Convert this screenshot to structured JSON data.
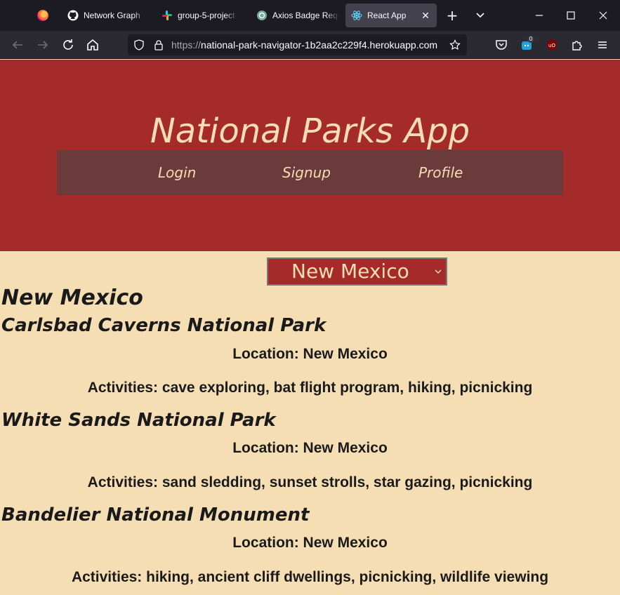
{
  "browser": {
    "tabs": [
      {
        "label": "Network Graph · ",
        "icon": "github-icon",
        "active": false
      },
      {
        "label": "group-5-project-",
        "icon": "slack-icon",
        "active": false
      },
      {
        "label": "Axios Badge Requ",
        "icon": "chatgpt-icon",
        "active": false
      },
      {
        "label": "React App",
        "icon": "react-icon",
        "active": true
      }
    ],
    "url_prefix": "https://",
    "url_domain": "national-park-navigator-1b2aa2c229f4.herokuapp.com",
    "extension_badge": "0"
  },
  "app": {
    "title": "National Parks App",
    "nav": {
      "login": "Login",
      "signup": "Signup",
      "profile": "Profile"
    },
    "selected_state": "New Mexico",
    "state_heading": "New Mexico",
    "parks": [
      {
        "name": "Carlsbad Caverns National Park",
        "location": "Location: New Mexico",
        "activities": "Activities: cave exploring, bat flight program, hiking, picnicking"
      },
      {
        "name": "White Sands National Park",
        "location": "Location: New Mexico",
        "activities": "Activities: sand sledding, sunset strolls, star gazing, picnicking"
      },
      {
        "name": "Bandelier National Monument",
        "location": "Location: New Mexico",
        "activities": "Activities: hiking, ancient cliff dwellings, picnicking, wildlife viewing"
      }
    ]
  },
  "colors": {
    "header_bg": "#a52a2a",
    "nav_bg": "#6b3a3a",
    "page_bg": "#f5deb3",
    "accent_text": "#f5deb3"
  }
}
